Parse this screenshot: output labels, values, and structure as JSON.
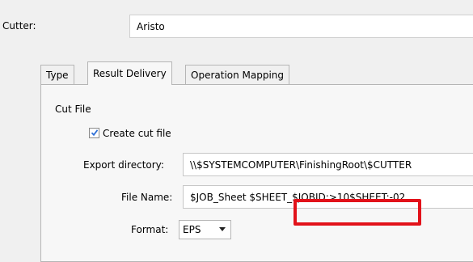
{
  "cutter": {
    "label": "Cutter:",
    "value": "Aristo"
  },
  "tabs": [
    {
      "label": "Type",
      "active": false
    },
    {
      "label": "Result Delivery",
      "active": true
    },
    {
      "label": "Operation Mapping",
      "active": false
    }
  ],
  "result_delivery": {
    "section_title": "Cut File",
    "create_cut_file": {
      "label": "Create cut file",
      "checked": true
    },
    "export_directory": {
      "label": "Export directory:",
      "value": "\\\\$SYSTEMCOMPUTER\\FinishingRoot\\$CUTTER"
    },
    "file_name": {
      "label": "File Name:",
      "value": "$JOB_Sheet $SHEET_$JOBID:>10$SHEET:-02"
    },
    "format": {
      "label": "Format:",
      "selected": "EPS"
    }
  },
  "colors": {
    "highlight": "#e2121a",
    "check_accent": "#2f6fd6"
  }
}
